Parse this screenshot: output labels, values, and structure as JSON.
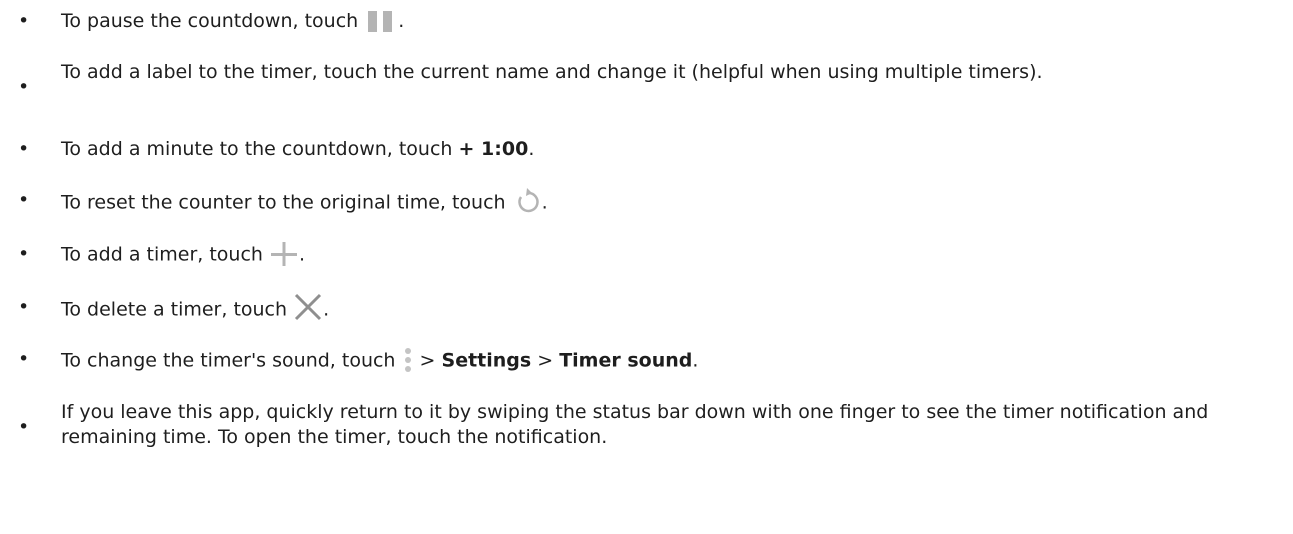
{
  "items": [
    {
      "pre": "To pause the countdown, touch ",
      "post": "."
    },
    {
      "text": "To add a label to the timer, touch the current name and change it (helpful when using multiple timers)."
    },
    {
      "pre": "To add a minute to the countdown, touch ",
      "bold": "+ 1:00",
      "post": "."
    },
    {
      "pre": "To reset the counter to the original time, touch ",
      "post": "."
    },
    {
      "pre": "To add a timer, touch ",
      "post": "."
    },
    {
      "pre": "To delete a timer, touch ",
      "post": "."
    },
    {
      "pre": "To change the timer's sound, touch ",
      "mid1": " > ",
      "bold1": "Settings",
      "mid2": " > ",
      "bold2": "Timer sound",
      "post": "."
    },
    {
      "text": "If you leave this app, quickly return to it by swiping the status bar down with one finger to see the timer notification and remaining time. To open the timer, touch the notification."
    }
  ],
  "bullet_char": "•",
  "icons": [
    "pause-icon",
    "reset-icon",
    "plus-icon",
    "close-icon",
    "more-vert-icon"
  ],
  "icon_color": "#b4b4b4"
}
